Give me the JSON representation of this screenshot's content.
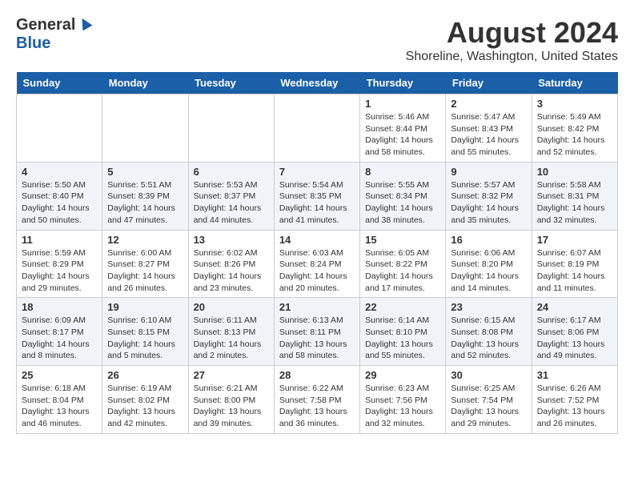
{
  "logo": {
    "general": "General",
    "blue": "Blue"
  },
  "title": "August 2024",
  "subtitle": "Shoreline, Washington, United States",
  "days_of_week": [
    "Sunday",
    "Monday",
    "Tuesday",
    "Wednesday",
    "Thursday",
    "Friday",
    "Saturday"
  ],
  "weeks": [
    [
      {
        "day": "",
        "info": ""
      },
      {
        "day": "",
        "info": ""
      },
      {
        "day": "",
        "info": ""
      },
      {
        "day": "",
        "info": ""
      },
      {
        "day": "1",
        "info": "Sunrise: 5:46 AM\nSunset: 8:44 PM\nDaylight: 14 hours\nand 58 minutes."
      },
      {
        "day": "2",
        "info": "Sunrise: 5:47 AM\nSunset: 8:43 PM\nDaylight: 14 hours\nand 55 minutes."
      },
      {
        "day": "3",
        "info": "Sunrise: 5:49 AM\nSunset: 8:42 PM\nDaylight: 14 hours\nand 52 minutes."
      }
    ],
    [
      {
        "day": "4",
        "info": "Sunrise: 5:50 AM\nSunset: 8:40 PM\nDaylight: 14 hours\nand 50 minutes."
      },
      {
        "day": "5",
        "info": "Sunrise: 5:51 AM\nSunset: 8:39 PM\nDaylight: 14 hours\nand 47 minutes."
      },
      {
        "day": "6",
        "info": "Sunrise: 5:53 AM\nSunset: 8:37 PM\nDaylight: 14 hours\nand 44 minutes."
      },
      {
        "day": "7",
        "info": "Sunrise: 5:54 AM\nSunset: 8:35 PM\nDaylight: 14 hours\nand 41 minutes."
      },
      {
        "day": "8",
        "info": "Sunrise: 5:55 AM\nSunset: 8:34 PM\nDaylight: 14 hours\nand 38 minutes."
      },
      {
        "day": "9",
        "info": "Sunrise: 5:57 AM\nSunset: 8:32 PM\nDaylight: 14 hours\nand 35 minutes."
      },
      {
        "day": "10",
        "info": "Sunrise: 5:58 AM\nSunset: 8:31 PM\nDaylight: 14 hours\nand 32 minutes."
      }
    ],
    [
      {
        "day": "11",
        "info": "Sunrise: 5:59 AM\nSunset: 8:29 PM\nDaylight: 14 hours\nand 29 minutes."
      },
      {
        "day": "12",
        "info": "Sunrise: 6:00 AM\nSunset: 8:27 PM\nDaylight: 14 hours\nand 26 minutes."
      },
      {
        "day": "13",
        "info": "Sunrise: 6:02 AM\nSunset: 8:26 PM\nDaylight: 14 hours\nand 23 minutes."
      },
      {
        "day": "14",
        "info": "Sunrise: 6:03 AM\nSunset: 8:24 PM\nDaylight: 14 hours\nand 20 minutes."
      },
      {
        "day": "15",
        "info": "Sunrise: 6:05 AM\nSunset: 8:22 PM\nDaylight: 14 hours\nand 17 minutes."
      },
      {
        "day": "16",
        "info": "Sunrise: 6:06 AM\nSunset: 8:20 PM\nDaylight: 14 hours\nand 14 minutes."
      },
      {
        "day": "17",
        "info": "Sunrise: 6:07 AM\nSunset: 8:19 PM\nDaylight: 14 hours\nand 11 minutes."
      }
    ],
    [
      {
        "day": "18",
        "info": "Sunrise: 6:09 AM\nSunset: 8:17 PM\nDaylight: 14 hours\nand 8 minutes."
      },
      {
        "day": "19",
        "info": "Sunrise: 6:10 AM\nSunset: 8:15 PM\nDaylight: 14 hours\nand 5 minutes."
      },
      {
        "day": "20",
        "info": "Sunrise: 6:11 AM\nSunset: 8:13 PM\nDaylight: 14 hours\nand 2 minutes."
      },
      {
        "day": "21",
        "info": "Sunrise: 6:13 AM\nSunset: 8:11 PM\nDaylight: 13 hours\nand 58 minutes."
      },
      {
        "day": "22",
        "info": "Sunrise: 6:14 AM\nSunset: 8:10 PM\nDaylight: 13 hours\nand 55 minutes."
      },
      {
        "day": "23",
        "info": "Sunrise: 6:15 AM\nSunset: 8:08 PM\nDaylight: 13 hours\nand 52 minutes."
      },
      {
        "day": "24",
        "info": "Sunrise: 6:17 AM\nSunset: 8:06 PM\nDaylight: 13 hours\nand 49 minutes."
      }
    ],
    [
      {
        "day": "25",
        "info": "Sunrise: 6:18 AM\nSunset: 8:04 PM\nDaylight: 13 hours\nand 46 minutes."
      },
      {
        "day": "26",
        "info": "Sunrise: 6:19 AM\nSunset: 8:02 PM\nDaylight: 13 hours\nand 42 minutes."
      },
      {
        "day": "27",
        "info": "Sunrise: 6:21 AM\nSunset: 8:00 PM\nDaylight: 13 hours\nand 39 minutes."
      },
      {
        "day": "28",
        "info": "Sunrise: 6:22 AM\nSunset: 7:58 PM\nDaylight: 13 hours\nand 36 minutes."
      },
      {
        "day": "29",
        "info": "Sunrise: 6:23 AM\nSunset: 7:56 PM\nDaylight: 13 hours\nand 32 minutes."
      },
      {
        "day": "30",
        "info": "Sunrise: 6:25 AM\nSunset: 7:54 PM\nDaylight: 13 hours\nand 29 minutes."
      },
      {
        "day": "31",
        "info": "Sunrise: 6:26 AM\nSunset: 7:52 PM\nDaylight: 13 hours\nand 26 minutes."
      }
    ]
  ]
}
